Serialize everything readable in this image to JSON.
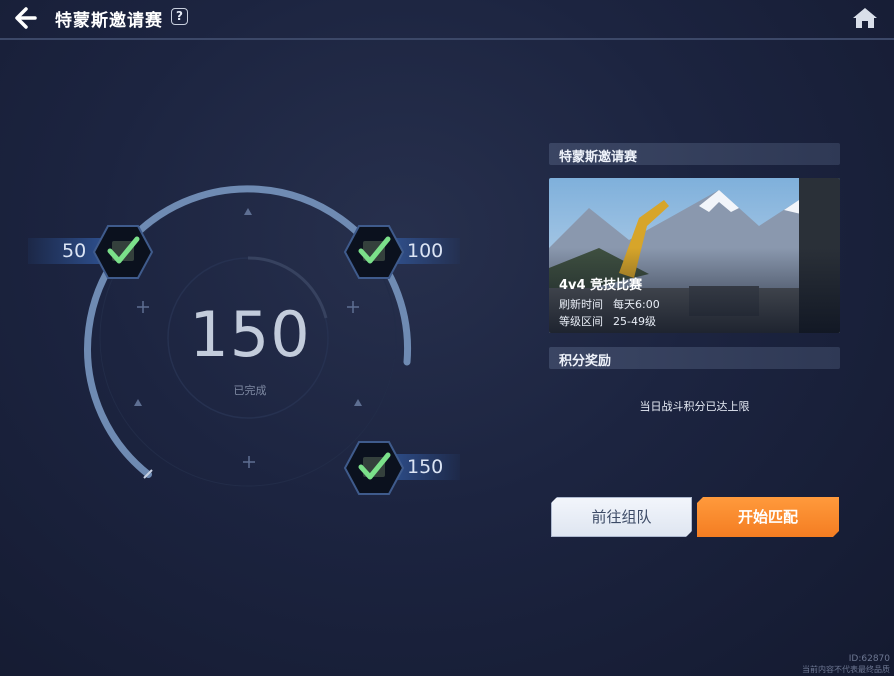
{
  "header": {
    "title": "特蒙斯邀请赛",
    "help": "?"
  },
  "dial": {
    "progress": 150,
    "status": "已完成",
    "milestones": [
      {
        "value": "50",
        "completed": true
      },
      {
        "value": "100",
        "completed": true
      },
      {
        "value": "150",
        "completed": true
      }
    ]
  },
  "panel": {
    "event_header": "特蒙斯邀请赛",
    "banner": {
      "mode": "4v4 竞技比赛",
      "refresh_label": "刷新时间",
      "refresh_value": "每天6:00",
      "level_label": "等级区间",
      "level_value": "25-49级"
    },
    "reward_header": "积分奖励",
    "reward_text": "当日战斗积分已达上限"
  },
  "buttons": {
    "team": "前往组队",
    "match": "开始匹配"
  },
  "watermark": {
    "line1": "ID:62870",
    "line2": "当前内容不代表最终品质"
  },
  "colors": {
    "accent_orange": "#f47d22",
    "check_green": "#7be08a",
    "ring": "#6f8bb3"
  }
}
